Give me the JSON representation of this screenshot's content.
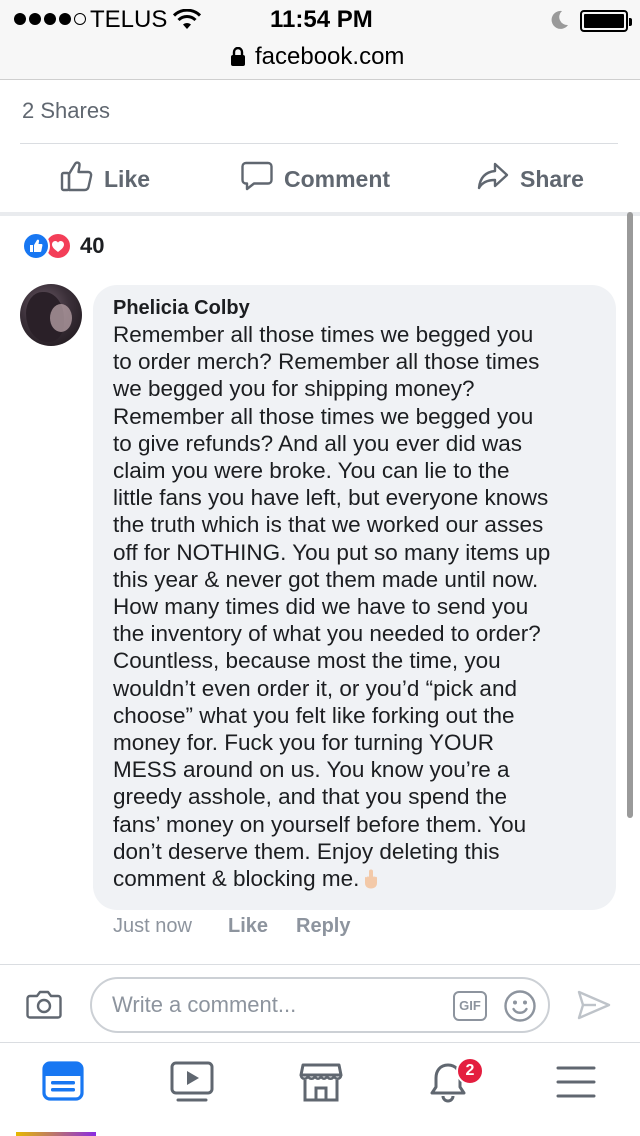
{
  "status_bar": {
    "carrier": "TELUS",
    "time": "11:54 PM"
  },
  "browser": {
    "url": "facebook.com"
  },
  "post": {
    "shares_text": "2 Shares",
    "actions": {
      "like": "Like",
      "comment": "Comment",
      "share": "Share"
    },
    "reactions": {
      "count": "40",
      "types": [
        "like-icon",
        "love-icon"
      ]
    }
  },
  "comment": {
    "author": "Phelicia Colby",
    "text": "Remember all those times we begged you\nto order merch? Remember all those times\nwe begged you for shipping money?\nRemember all those times we begged you\nto give refunds? And all you ever did was\nclaim you were broke. You can lie to the\nlittle fans you have left, but everyone knows\nthe truth which is that we worked our asses\noff for NOTHING. You put so many items up\nthis year & never got them made until now.\nHow many times did we have to send you\nthe inventory of what you needed to order?\nCountless, because most the time, you\nwouldn’t even order it, or you’d “pick and\nchoose” what you felt like forking out the\nmoney for. Fuck you for turning YOUR\nMESS around on us. You know you’re a\ngreedy asshole, and that you spend the\nfans’ money on yourself before them. You\ndon’t deserve them. Enjoy deleting this\ncomment & blocking me.",
    "emoji": "middle-finger-emoji",
    "time": "Just now",
    "like_label": "Like",
    "reply_label": "Reply"
  },
  "composer": {
    "placeholder": "Write a comment...",
    "gif_label": "GIF"
  },
  "bottom_nav": {
    "items": [
      "news-feed-icon",
      "watch-icon",
      "marketplace-icon",
      "notifications-icon",
      "menu-icon"
    ],
    "notifications_badge": "2"
  },
  "colors": {
    "facebook_blue": "#1877f2",
    "love_red": "#f33e58",
    "badge_red": "#e41e3f",
    "bubble_bg": "#f0f2f5",
    "muted_text": "#606770"
  }
}
